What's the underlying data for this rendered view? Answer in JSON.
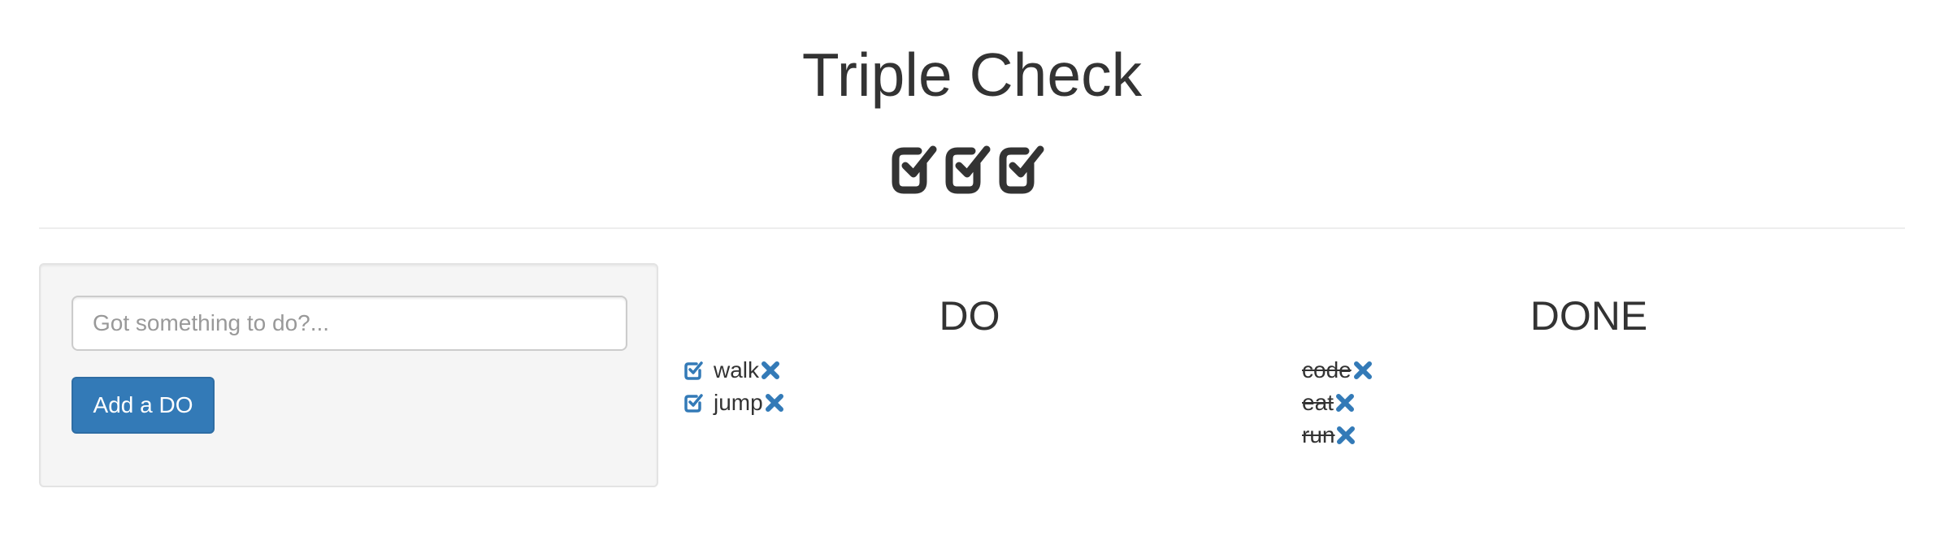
{
  "header": {
    "title": "Triple Check",
    "logo_icon": "triple-check-square-icon"
  },
  "form": {
    "input_placeholder": "Got something to do?...",
    "input_value": "",
    "add_button_label": "Add a DO"
  },
  "do_column": {
    "heading": "DO",
    "items": [
      {
        "text": "walk",
        "check_icon": "check-square-icon",
        "delete_icon": "close-icon"
      },
      {
        "text": "jump",
        "check_icon": "check-square-icon",
        "delete_icon": "close-icon"
      }
    ]
  },
  "done_column": {
    "heading": "DONE",
    "items": [
      {
        "text": "code",
        "delete_icon": "close-icon"
      },
      {
        "text": "eat",
        "delete_icon": "close-icon"
      },
      {
        "text": "run",
        "delete_icon": "close-icon"
      }
    ]
  },
  "colors": {
    "text": "#333333",
    "accent": "#337ab7",
    "well_background": "#f5f5f5",
    "divider": "#eeeeee"
  }
}
